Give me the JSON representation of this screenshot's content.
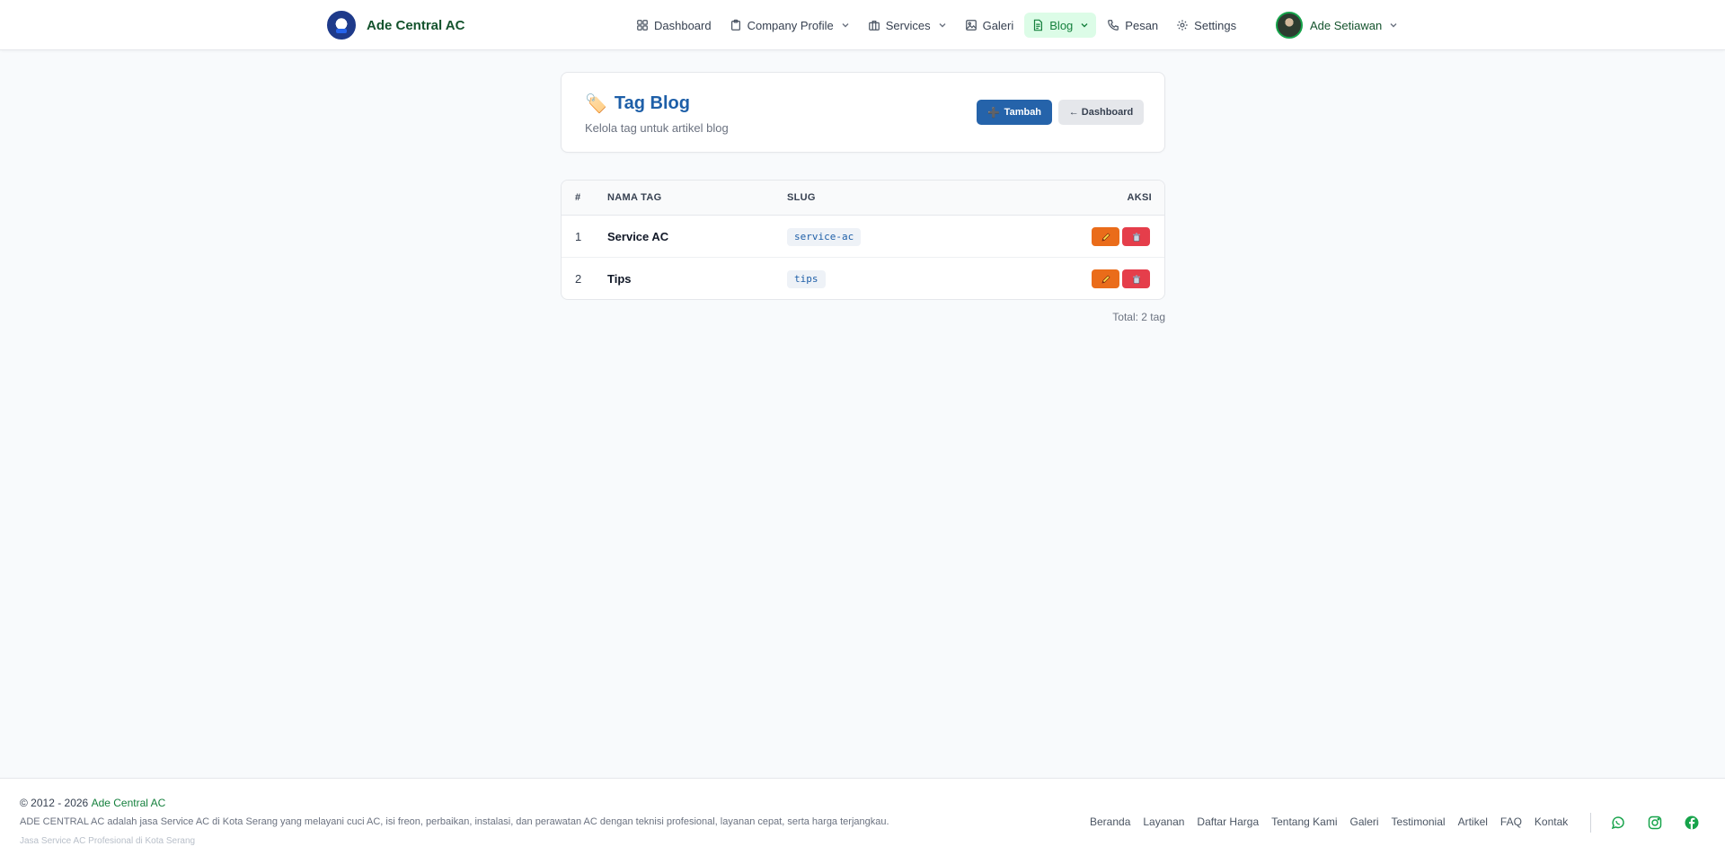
{
  "brand": {
    "name": "Ade Central AC"
  },
  "nav": {
    "items": [
      {
        "label": "Dashboard",
        "icon": "grid-icon"
      },
      {
        "label": "Company Profile",
        "icon": "clipboard-icon",
        "has_dropdown": true
      },
      {
        "label": "Services",
        "icon": "briefcase-icon",
        "has_dropdown": true
      },
      {
        "label": "Galeri",
        "icon": "image-icon"
      },
      {
        "label": "Blog",
        "icon": "document-icon",
        "has_dropdown": true,
        "active": true
      },
      {
        "label": "Pesan",
        "icon": "phone-icon"
      },
      {
        "label": "Settings",
        "icon": "settings-icon"
      }
    ],
    "user_name": "Ade Setiawan"
  },
  "header": {
    "icon": "🏷️",
    "title": "Tag Blog",
    "subtitle": "Kelola tag untuk artikel blog",
    "add_button": "Tambah",
    "add_button_icon": "➕",
    "back_button": "← Dashboard"
  },
  "table": {
    "columns": {
      "num": "#",
      "name": "NAMA TAG",
      "slug": "SLUG",
      "actions": "AKSI"
    },
    "rows": [
      {
        "num": "1",
        "name": "Service AC",
        "slug": "service-ac"
      },
      {
        "num": "2",
        "name": "Tips",
        "slug": "tips"
      }
    ],
    "edit_icon": "pencil-icon",
    "delete_icon": "trash-icon",
    "total": "Total: 2 tag"
  },
  "footer": {
    "copyright_prefix": "© 2012 - 2026",
    "copyright_brand": "Ade Central AC",
    "description": "ADE CENTRAL AC adalah jasa Service AC di Kota Serang yang melayani cuci AC, isi freon, perbaikan, instalasi, dan perawatan AC dengan teknisi profesional, layanan cepat, serta harga terjangkau.",
    "tagline": "Jasa Service AC Profesional di Kota Serang",
    "links": [
      "Beranda",
      "Layanan",
      "Daftar Harga",
      "Tentang Kami",
      "Galeri",
      "Testimonial",
      "Artikel",
      "FAQ",
      "Kontak"
    ],
    "social": [
      "whatsapp-icon",
      "instagram-icon",
      "facebook-icon"
    ]
  },
  "colors": {
    "accent_green": "#15803d",
    "title_blue": "#1e5fa8",
    "primary_button": "#2563aa",
    "edit_orange": "#ea6c1a",
    "delete_red": "#e53e4b"
  }
}
